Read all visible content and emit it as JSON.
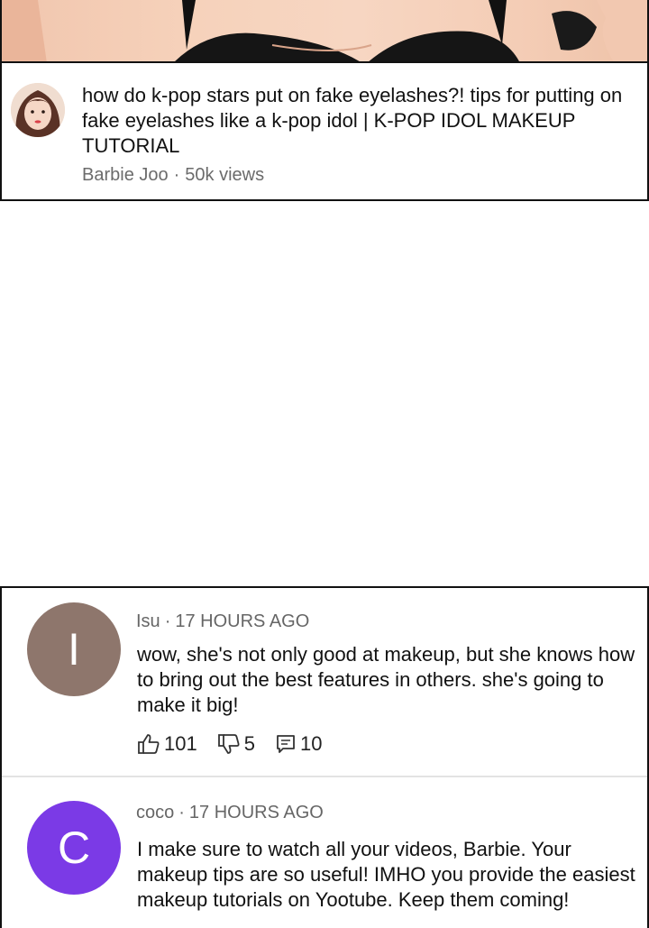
{
  "video": {
    "title": "how do k-pop stars put on fake eyelashes?! tips for putting on fake eyelashes like a k-pop idol | K-POP IDOL MAKEUP TUTORIAL",
    "channel": "Barbie Joo",
    "separator": "·",
    "views": "50k views"
  },
  "comments": [
    {
      "avatar_letter": "I",
      "avatar_color": "#8e766c",
      "author": "Isu",
      "separator": "·",
      "time": "17 HOURS AGO",
      "text": "wow, she's not only good at makeup, but she knows how to bring out the best features in others. she's going to make it big!",
      "likes": "101",
      "dislikes": "5",
      "replies": "10"
    },
    {
      "avatar_letter": "C",
      "avatar_color": "#7b3ae6",
      "author": "coco",
      "separator": "·",
      "time": "17 HOURS AGO",
      "text": "I make sure to watch all your videos, Barbie. Your makeup tips are so useful! IMHO you provide the easiest makeup tutorials on Yootube. Keep them coming!"
    }
  ],
  "icons": {
    "like": "thumbs-up-icon",
    "dislike": "thumbs-down-icon",
    "reply": "reply-icon"
  }
}
